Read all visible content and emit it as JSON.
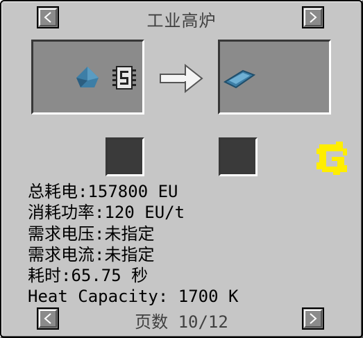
{
  "title": "工业高炉",
  "nav": {
    "prev_icon": "chevron-left-icon",
    "next_icon": "chevron-right-icon"
  },
  "recipe": {
    "inputs": [
      "blue-gem-dust-icon",
      "circuit-chip-icon"
    ],
    "arrow_icon": "arrow-right-icon",
    "outputs": [
      "blue-ingot-icon"
    ],
    "corner_icon": "gregtech-logo-icon"
  },
  "info": {
    "total_eu": "总耗电:157800 EU",
    "power": "消耗功率:120 EU/t",
    "voltage": "需求电压:未指定",
    "current": "需求电流:未指定",
    "time": "耗时:65.75 秒",
    "heat": "Heat Capacity: 1700 K"
  },
  "page": {
    "label": "页数 10/12"
  },
  "colors": {
    "panel": "#c6c6c6",
    "slot": "#8b8b8b",
    "dark_slot": "#3a3a3a",
    "logo": "#ffee00",
    "item_blue": "#3d7ea6"
  }
}
